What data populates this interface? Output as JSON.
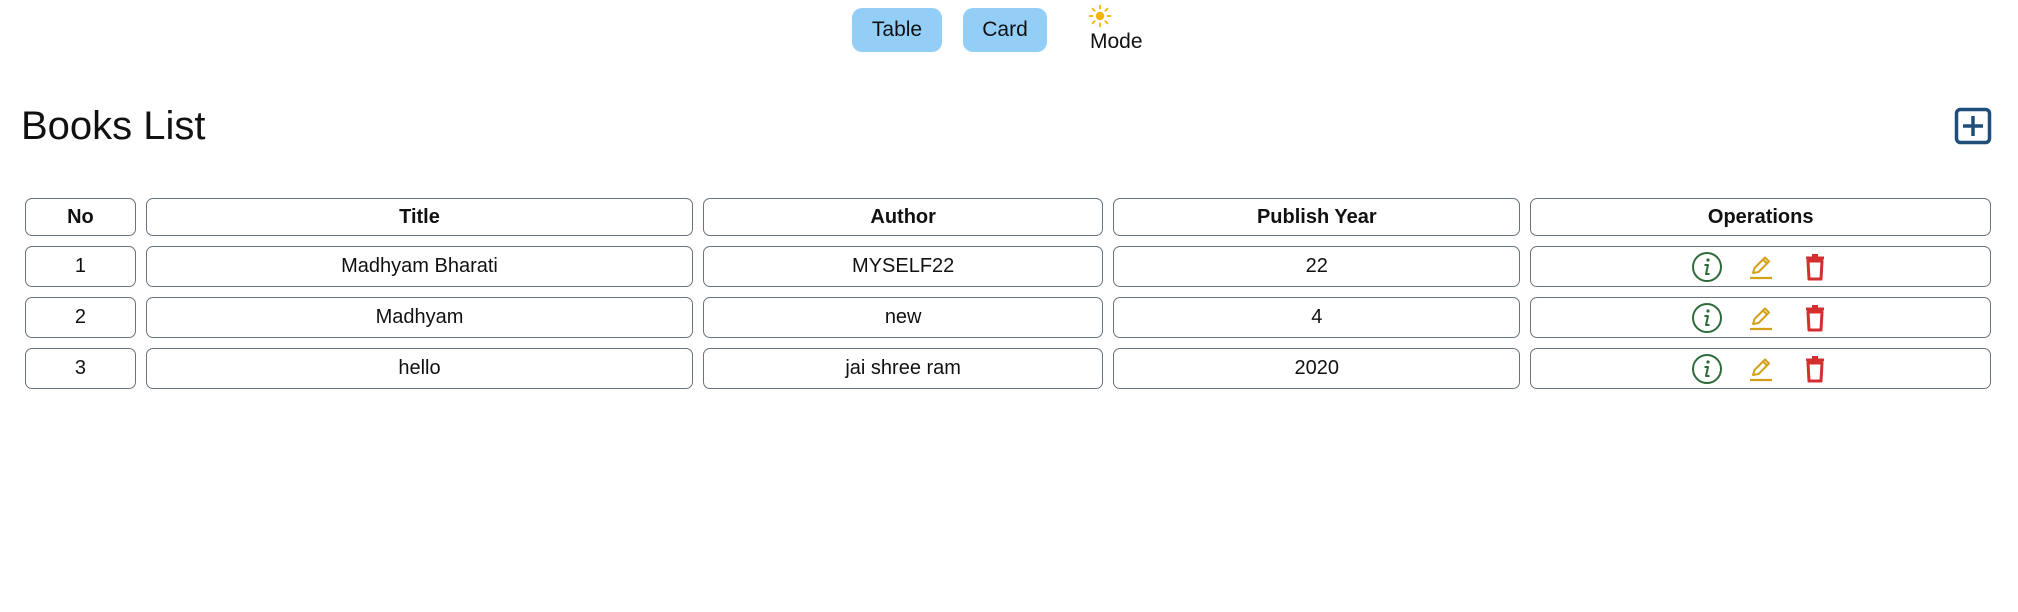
{
  "topbar": {
    "table_label": "Table",
    "card_label": "Card",
    "mode_label": "Mode",
    "mode_icon": "sun-icon"
  },
  "page": {
    "title": "Books List",
    "add_icon": "plus-square-icon"
  },
  "table": {
    "headers": [
      "No",
      "Title",
      "Author",
      "Publish Year",
      "Operations"
    ],
    "rows": [
      {
        "no": "1",
        "title": "Madhyam Bharati",
        "author": "MYSELF22",
        "year": "22"
      },
      {
        "no": "2",
        "title": "Madhyam",
        "author": "new",
        "year": "4"
      },
      {
        "no": "3",
        "title": "hello",
        "author": "jai shree ram",
        "year": "2020"
      }
    ],
    "operation_icons": [
      "info-icon",
      "edit-icon",
      "delete-icon"
    ]
  },
  "colors": {
    "button_bg": "#93cef7",
    "sun": "#f4b400",
    "add_icon": "#1e4e79",
    "info": "#2f6b3a",
    "edit": "#d4a017",
    "delete": "#d32f2f",
    "border": "#6b7280"
  }
}
